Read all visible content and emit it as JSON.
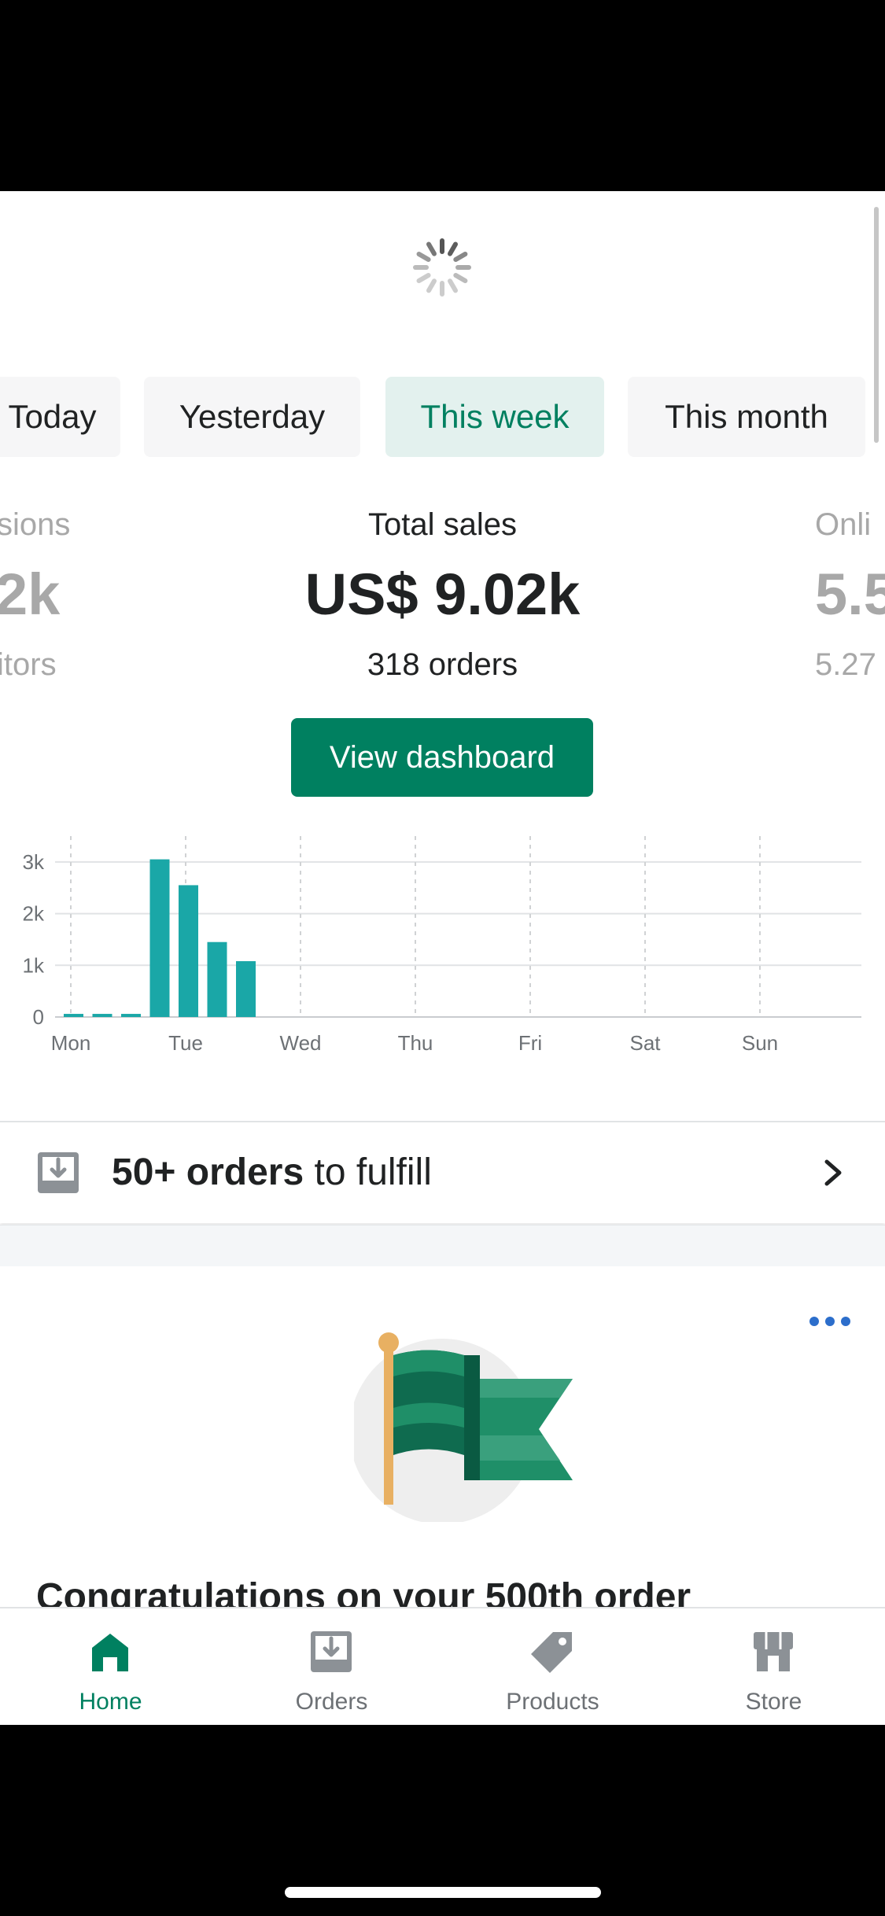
{
  "tabs": [
    {
      "label": "Today"
    },
    {
      "label": "Yesterday"
    },
    {
      "label": "This week"
    },
    {
      "label": "This month"
    }
  ],
  "metrics": {
    "left": {
      "label": "sions",
      "value": "2k",
      "sub": "itors"
    },
    "center": {
      "label": "Total sales",
      "value": "US$ 9.02k",
      "sub": "318 orders"
    },
    "right": {
      "label": "Onli",
      "value": "5.5",
      "sub": "5.27"
    }
  },
  "dashboard_button": "View dashboard",
  "chart_data": {
    "type": "bar",
    "categories": [
      "Mon",
      "Tue",
      "Wed",
      "Thu",
      "Fri",
      "Sat",
      "Sun"
    ],
    "y_ticks": [
      "0",
      "1k",
      "2k",
      "3k"
    ],
    "ylim": [
      0,
      3500
    ],
    "grid": true,
    "values_per_hour_block": [
      60,
      60,
      60,
      3050,
      2550,
      1450,
      1080,
      0,
      0,
      0,
      0,
      0,
      0,
      0,
      0,
      0,
      0,
      0,
      0,
      0,
      0,
      0,
      0,
      0,
      0,
      0,
      0,
      0
    ]
  },
  "fulfill": {
    "bold": "50+ orders",
    "rest": " to fulfill"
  },
  "card": {
    "title": "Congratulations on your 500th order"
  },
  "nav": [
    {
      "label": "Home"
    },
    {
      "label": "Orders"
    },
    {
      "label": "Products"
    },
    {
      "label": "Store"
    }
  ],
  "colors": {
    "accent": "#008060",
    "bar": "#1aa7a7",
    "active_tab_bg": "#e3f1ee"
  }
}
